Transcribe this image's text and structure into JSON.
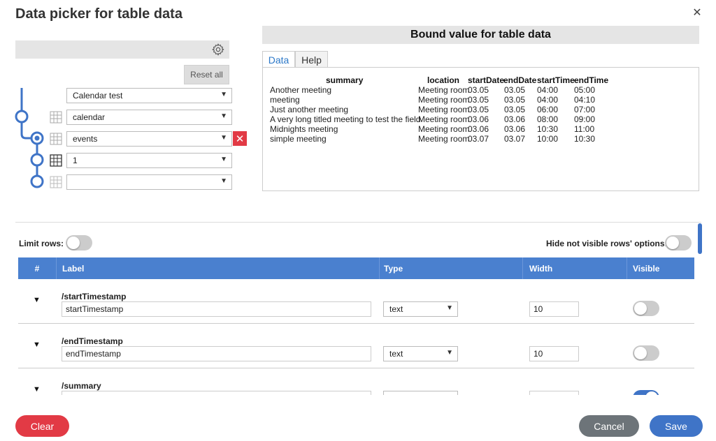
{
  "dialog": {
    "title": "Data picker for table data",
    "close_icon": "✕"
  },
  "picker": {
    "reset_label": "Reset all",
    "selects": [
      {
        "value": "Calendar test"
      },
      {
        "value": "calendar"
      },
      {
        "value": "events"
      },
      {
        "value": "1"
      },
      {
        "value": ""
      }
    ],
    "remove_label": "✕"
  },
  "bound": {
    "header": "Bound value for table data",
    "tabs": [
      "Data",
      "Help"
    ],
    "columns": [
      "summary",
      "location",
      "startDate",
      "endDate",
      "startTime",
      "endTime"
    ],
    "rows": [
      [
        "Another meeting",
        "Meeting room",
        "03.05",
        "03.05",
        "04:00",
        "05:00"
      ],
      [
        "meeting",
        "Meeting room",
        "03.05",
        "03.05",
        "04:00",
        "04:10"
      ],
      [
        "Just another meeting",
        "Meeting room",
        "03.05",
        "03.05",
        "06:00",
        "07:00"
      ],
      [
        "A very long titled meeting to test the field",
        "Meeting room",
        "03.06",
        "03.06",
        "08:00",
        "09:00"
      ],
      [
        "Midnights meeting",
        "Meeting room",
        "03.06",
        "03.06",
        "10:30",
        "11:00"
      ],
      [
        "simple meeting",
        "Meeting room",
        "03.07",
        "03.07",
        "10:00",
        "10:30"
      ]
    ]
  },
  "options": {
    "limit_rows_label": "Limit rows:",
    "limit_rows_on": false,
    "hide_rows_label": "Hide not visible rows' options:",
    "hide_rows_on": false
  },
  "columns_table": {
    "headers": [
      "#",
      "Label",
      "Type",
      "Width",
      "Visible"
    ],
    "rows": [
      {
        "path": "/startTimestamp",
        "label": "startTimestamp",
        "type": "text",
        "width": "10",
        "visible": false
      },
      {
        "path": "/endTimestamp",
        "label": "endTimestamp",
        "type": "text",
        "width": "10",
        "visible": false
      },
      {
        "path": "/summary",
        "label": "",
        "type": "",
        "width": "",
        "visible": true
      }
    ]
  },
  "footer": {
    "clear_label": "Clear",
    "cancel_label": "Cancel",
    "save_label": "Save"
  },
  "colors": {
    "accent": "#3f74c7",
    "danger": "#e23a45",
    "neutral": "#6d7479"
  }
}
